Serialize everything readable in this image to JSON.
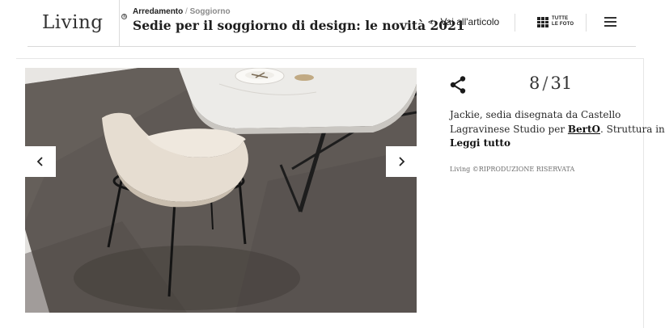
{
  "header": {
    "logo": "Living",
    "logo_mark": "®",
    "breadcrumb": {
      "section": "Arredamento",
      "separator": "/",
      "subsection": "Soggiorno"
    },
    "title": "Sedie per il soggiorno di design: le novità 2021",
    "back_link": {
      "icon": "chevron-left-icon",
      "label": "Vai all'articolo"
    },
    "all_photos": {
      "icon": "grid-icon",
      "label_line1": "TUTTE",
      "label_line2": "LE FOTO"
    },
    "menu_icon": "hamburger-menu-icon"
  },
  "gallery": {
    "current": "8",
    "separator": "/",
    "total": "31",
    "prev_icon": "chevron-left-icon",
    "next_icon": "chevron-right-icon",
    "share_icon": "share-icon"
  },
  "caption": {
    "line1": "Jackie, sedia disegnata da Castello",
    "line2_before": "Lagravinese Studio per ",
    "brand": "BertO",
    "line2_after": ". Struttura in...",
    "read_more": "Leggi tutto",
    "credit": "Living ©RIPRODUZIONE RISERVATA"
  }
}
